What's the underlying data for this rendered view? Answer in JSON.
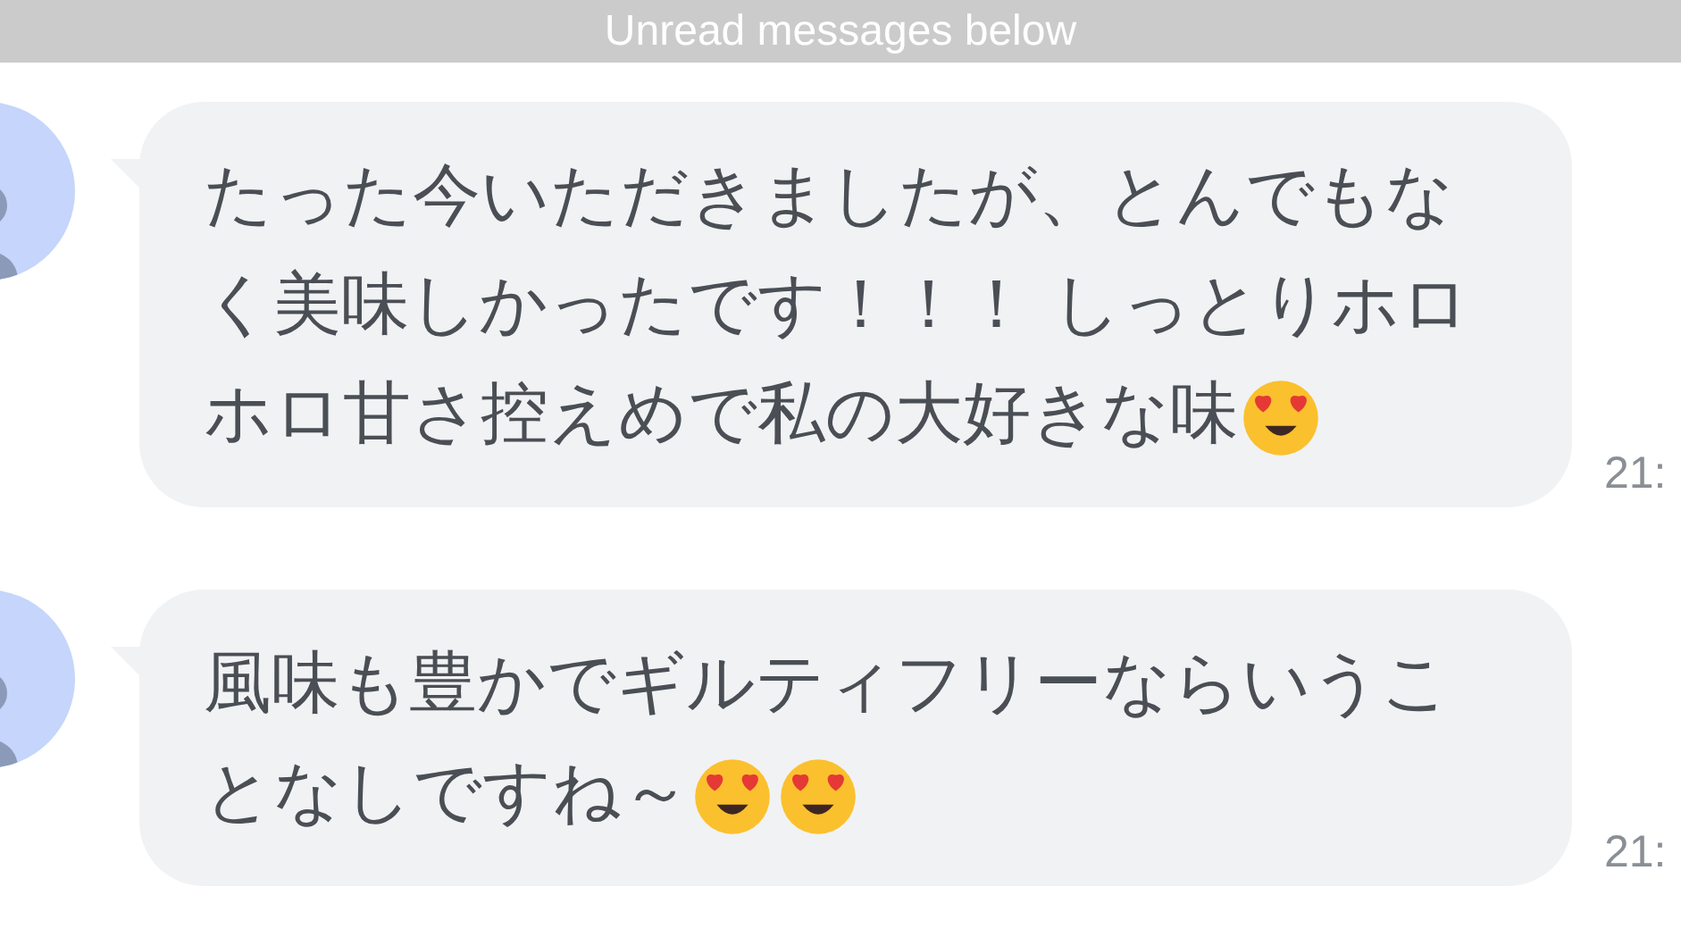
{
  "banner": {
    "text": "Unread messages below"
  },
  "messages": [
    {
      "text": "たった今いただきましたが、とんでもなく美味しかったです！！！ しっとりホロホロ甘さ控えめで私の大好きな味",
      "emojis": [
        {
          "kind": "heart_eyes"
        }
      ],
      "time": "21:"
    },
    {
      "text": "風味も豊かでギルティフリーならいうことなしですね～",
      "emojis": [
        {
          "kind": "heart_eyes"
        },
        {
          "kind": "heart_eyes"
        }
      ],
      "time": "21:"
    }
  ]
}
